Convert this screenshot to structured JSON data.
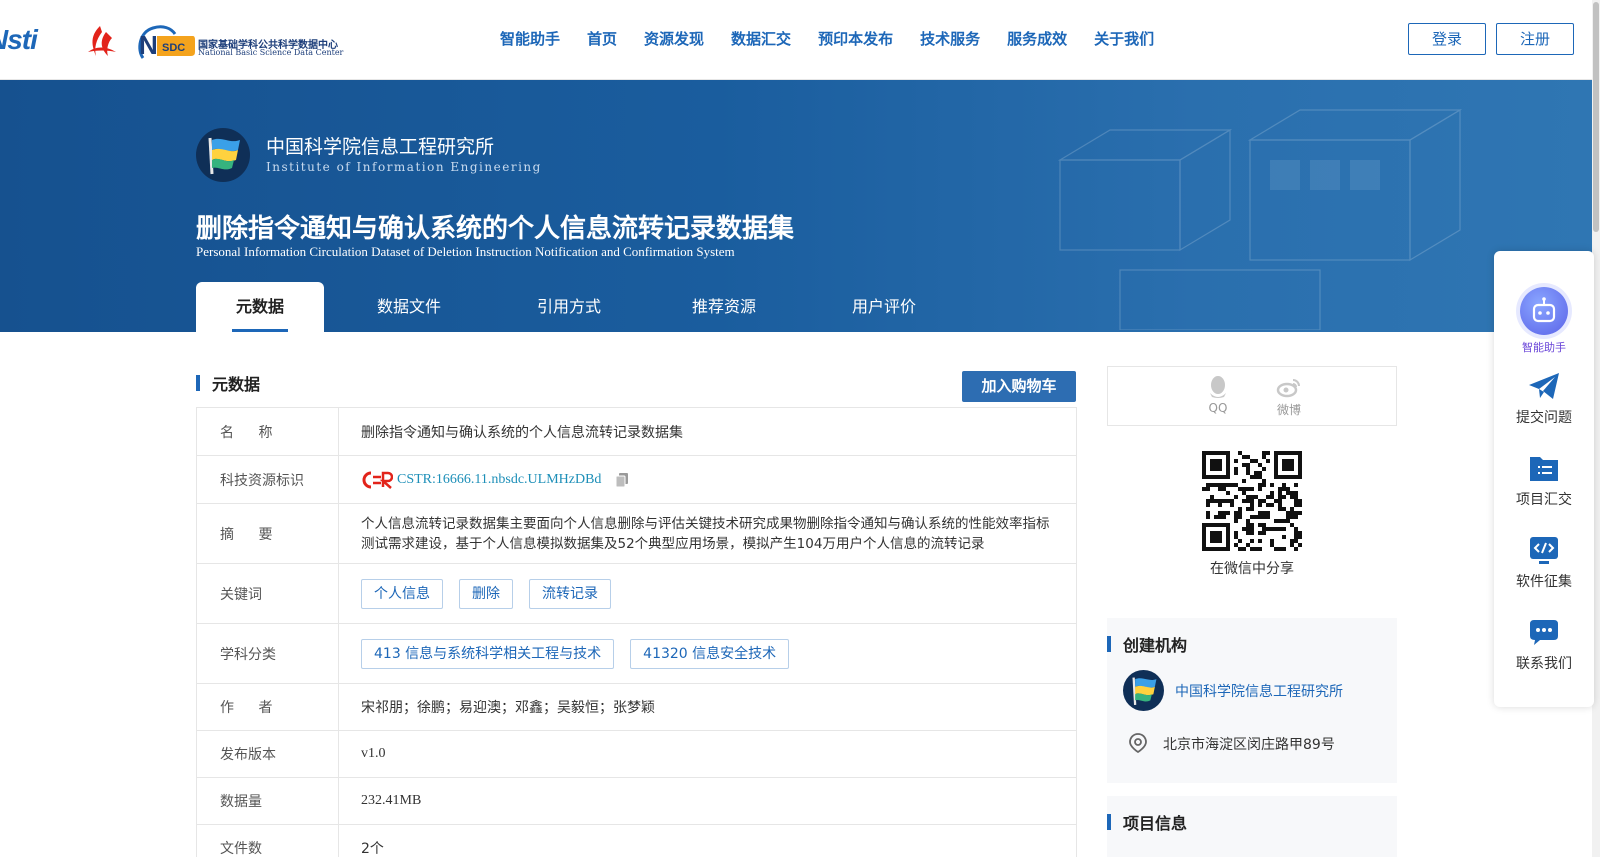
{
  "header": {
    "logo_nsti_text": "Nsti",
    "logo_nsdc_cn": "国家基础学科公共科学数据中心",
    "logo_nsdc_en": "National Basic Science Data Center",
    "logo_nsdc_badge": "SDC",
    "nav": [
      "智能助手",
      "首页",
      "资源发现",
      "数据汇交",
      "预印本发布",
      "技术服务",
      "服务成效",
      "关于我们"
    ],
    "login_label": "登录",
    "register_label": "注册"
  },
  "banner": {
    "institution_cn": "中国科学院信息工程研究所",
    "institution_en": "Institute of Information Engineering",
    "title": "删除指令通知与确认系统的个人信息流转记录数据集",
    "subtitle": "Personal Information Circulation Dataset of Deletion Instruction Notification and Confirmation System",
    "tabs": [
      "元数据",
      "数据文件",
      "引用方式",
      "推荐资源",
      "用户评价"
    ],
    "active_tab": "元数据"
  },
  "metadata": {
    "section_title": "元数据",
    "cart_button": "加入购物车",
    "rows": {
      "name": {
        "label": "名 称",
        "value": "删除指令通知与确认系统的个人信息流转记录数据集"
      },
      "identifier": {
        "label": "科技资源标识",
        "value": "CSTR:16666.11.nbsdc.ULMHzDBd"
      },
      "abstract": {
        "label": "摘 要",
        "value": "个人信息流转记录数据集主要面向个人信息删除与评估关键技术研究成果物删除指令通知与确认系统的性能效率指标测试需求建设，基于个人信息模拟数据集及52个典型应用场景，模拟产生104万用户个人信息的流转记录"
      },
      "keywords": {
        "label": "关键词",
        "tags": [
          "个人信息",
          "删除",
          "流转记录"
        ]
      },
      "subjects": {
        "label": "学科分类",
        "tags": [
          "413 信息与系统科学相关工程与技术",
          "41320 信息安全技术"
        ]
      },
      "authors": {
        "label": "作 者",
        "value": "宋祁朋；徐鹏；易迎澳；邓鑫；吴毅恒；张梦颖"
      },
      "version": {
        "label": "发布版本",
        "value": "v1.0"
      },
      "size": {
        "label": "数据量",
        "value": "232.41MB"
      },
      "files": {
        "label": "文件数",
        "value": "2个"
      }
    }
  },
  "share": {
    "qq_label": "QQ",
    "weibo_label": "微博",
    "wechat_caption": "在微信中分享"
  },
  "org_card": {
    "title": "创建机构",
    "name": "中国科学院信息工程研究所",
    "address": "北京市海淀区闵庄路甲89号"
  },
  "project_card": {
    "title": "项目信息"
  },
  "float_bar": [
    "智能助手",
    "提交问题",
    "项目汇交",
    "软件征集",
    "联系我们"
  ],
  "colors": {
    "brand_blue": "#1d67b8",
    "banner_blue": "#1a5d9e",
    "ai_purple": "#6a45d8"
  }
}
